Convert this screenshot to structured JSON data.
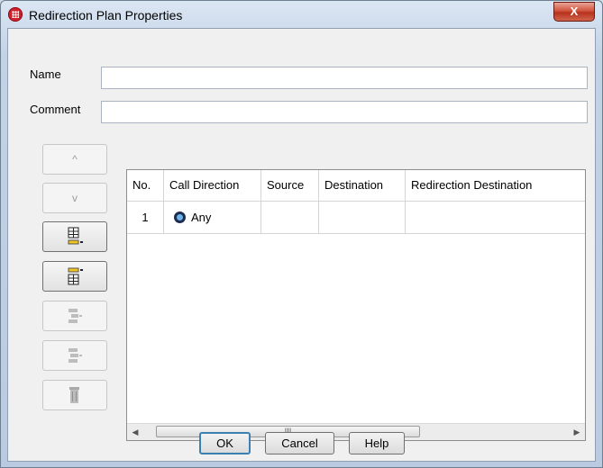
{
  "window": {
    "title": "Redirection Plan Properties",
    "close_label": "X"
  },
  "form": {
    "name_label": "Name",
    "name_value": "",
    "comment_label": "Comment",
    "comment_value": ""
  },
  "sidebar": {
    "up_label": "^",
    "down_label": "v"
  },
  "table": {
    "columns": [
      "No.",
      "Call Direction",
      "Source",
      "Destination",
      "Redirection Destination"
    ],
    "rows": [
      {
        "no": "1",
        "call_direction": "Any",
        "source": "",
        "destination": "",
        "redirection_destination": ""
      }
    ],
    "scroll_grip": "III"
  },
  "buttons": {
    "ok": "OK",
    "cancel": "Cancel",
    "help": "Help"
  },
  "colors": {
    "title_bar": "#c3d3e6",
    "close": "#c9442d",
    "dialog_bg": "#f0f0f0",
    "default_focus": "#3c7fb1"
  }
}
